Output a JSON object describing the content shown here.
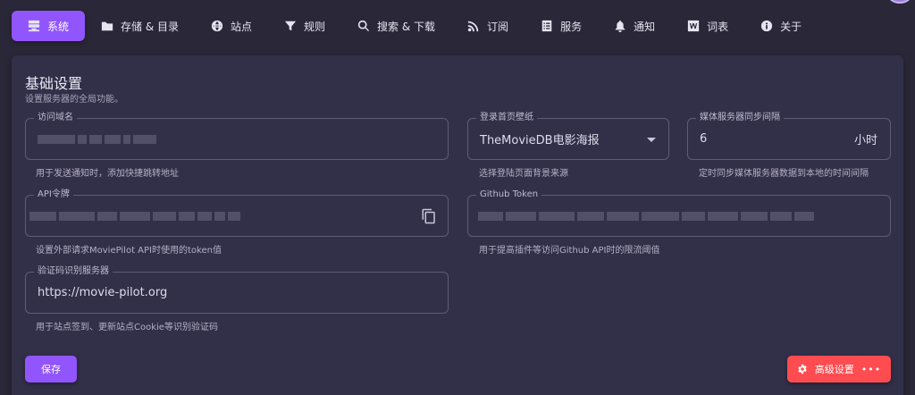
{
  "tabs": [
    {
      "label": "系统",
      "icon": "server-icon",
      "active": true
    },
    {
      "label": "存储 & 目录",
      "icon": "folder-icon",
      "active": false
    },
    {
      "label": "站点",
      "icon": "globe-icon",
      "active": false
    },
    {
      "label": "规则",
      "icon": "filter-icon",
      "active": false
    },
    {
      "label": "搜索 & 下载",
      "icon": "search-icon",
      "active": false
    },
    {
      "label": "订阅",
      "icon": "rss-icon",
      "active": false
    },
    {
      "label": "服务",
      "icon": "list-icon",
      "active": false
    },
    {
      "label": "通知",
      "icon": "bell-icon",
      "active": false
    },
    {
      "label": "词表",
      "icon": "word-icon",
      "active": false
    },
    {
      "label": "关于",
      "icon": "info-icon",
      "active": false
    }
  ],
  "card": {
    "title": "基础设置",
    "subtitle": "设置服务器的全局功能。"
  },
  "fields": {
    "domain": {
      "label": "访问域名",
      "hint": "用于发送通知时，添加快捷跳转地址"
    },
    "wallpaper": {
      "label": "登录首页壁纸",
      "value": "TheMovieDB电影海报",
      "hint": "选择登陆页面背景来源"
    },
    "sync": {
      "label": "媒体服务器同步间隔",
      "value": "6",
      "suffix": "小时",
      "hint": "定时同步媒体服务器数据到本地的时间间隔"
    },
    "api": {
      "label": "API令牌",
      "hint": "设置外部请求MoviePilot API时使用的token值"
    },
    "github": {
      "label": "Github Token",
      "hint": "用于提高插件等访问Github API时的限流阈值"
    },
    "ocr": {
      "label": "验证码识别服务器",
      "value": "https://movie-pilot.org",
      "hint": "用于站点签到、更新站点Cookie等识别验证码"
    }
  },
  "buttons": {
    "save": "保存",
    "advanced": "高级设置",
    "more": "•••"
  },
  "colors": {
    "accent": "#9155fd",
    "danger": "#ff4c51",
    "background": "#2a2838",
    "card": "#322f48"
  }
}
